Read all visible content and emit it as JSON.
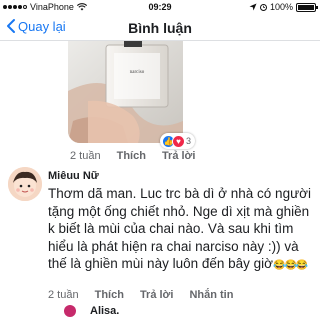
{
  "status_bar": {
    "carrier": "VinaPhone",
    "time": "09:29",
    "battery_level": "100%",
    "battery_fraction": 1.0
  },
  "nav": {
    "back_label": "Quay lại",
    "title": "Bình luận"
  },
  "comments": [
    {
      "type": "photo",
      "reaction_count": "3",
      "reaction_icons": [
        "like-icon",
        "love-icon"
      ],
      "actions": {
        "time": "2 tuần",
        "like": "Thích",
        "reply": "Trả lời"
      }
    },
    {
      "author": "Miêuu Nữ",
      "text": "Thơm dã man. Luc trc bà dì ở nhà có người tặng một ống chiết nhỏ. Nge dì xịt mà ghiền k biết là mùi của chai nào. Và sau khi tìm hiểu  là phát hiện ra chai narciso này :)) và thế là ghiền mùi này luôn đến bây giờ",
      "trailing_emoji": "😂😂😂",
      "actions": {
        "time": "2 tuần",
        "like": "Thích",
        "reply": "Trả lời",
        "message": "Nhắn tin"
      }
    },
    {
      "author": "Alisa."
    }
  ]
}
